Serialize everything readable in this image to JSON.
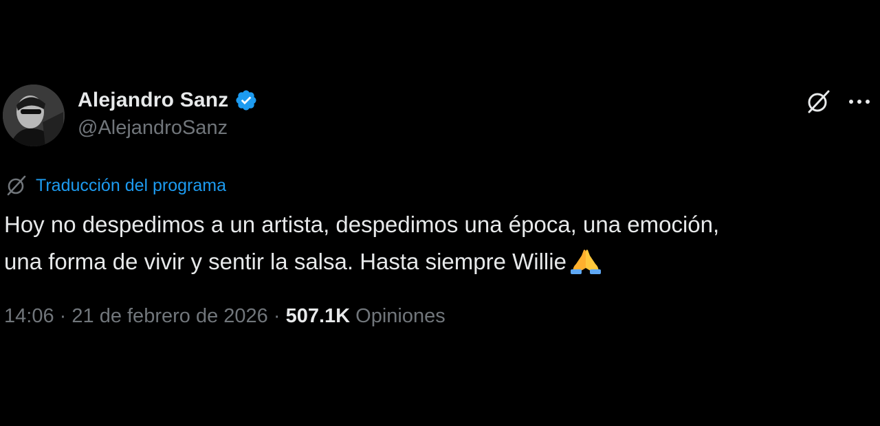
{
  "tweet": {
    "display_name": "Alejandro Sanz",
    "handle": "@AlejandroSanz",
    "verified": true,
    "avatar_icon": "avatar",
    "header_icons": [
      "grok-icon",
      "more-icon"
    ],
    "translation_label": "Traducción del programa",
    "text_line1": "Hoy no despedimos a un artista, despedimos una época, una emoción,",
    "text_line2": "una forma de vivir y sentir la salsa. Hasta siempre Willie",
    "emoji": "folded-hands-emoji",
    "time": "14:06",
    "separator": "·",
    "date": "21 de febrero de 2026",
    "views_count": "507.1K",
    "views_label": "Opiniones"
  },
  "colors": {
    "background": "#000000",
    "primary_text": "#e7e9ea",
    "secondary_text": "#71767b",
    "link": "#1d9bf0",
    "verified_badge": "#1d9bf0"
  }
}
